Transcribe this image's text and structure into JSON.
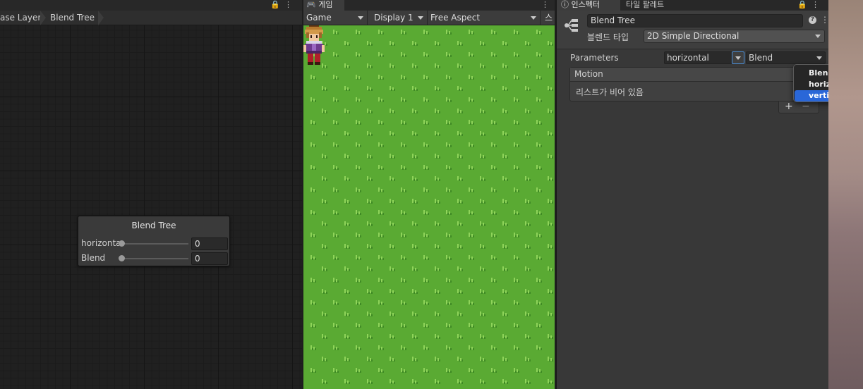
{
  "animator": {
    "breadcrumbs": [
      "ase Layer",
      "Blend Tree"
    ],
    "node": {
      "title": "Blend Tree",
      "params": [
        {
          "name": "horizonta",
          "value": "0"
        },
        {
          "name": "Blend",
          "value": "0"
        }
      ]
    }
  },
  "game": {
    "tab_label": "게임",
    "display_mode": "Game",
    "display": "Display 1",
    "aspect": "Free Aspect",
    "scale_label": "스",
    "colors": {
      "grass": "#5aaa33",
      "tuft_light": "#8fd35a",
      "tuft_dark": "#3f8a25"
    }
  },
  "inspector": {
    "tabs": [
      "인스펙터",
      "타일 팔레트"
    ],
    "asset_name": "Blend Tree",
    "blend_type_label": "블렌드 타입",
    "blend_type": "2D Simple Directional",
    "parameters_label": "Parameters",
    "param_x": "horizontal",
    "param_y": "Blend",
    "motion_header": "Motion",
    "motion_empty": "리스트가 비어 있음",
    "add_label": "+",
    "remove_label": "−"
  },
  "dropdown": {
    "options": [
      "Blend",
      "horizontal",
      "vertical"
    ],
    "selected": "vertical",
    "accent": "#2a67d8"
  }
}
